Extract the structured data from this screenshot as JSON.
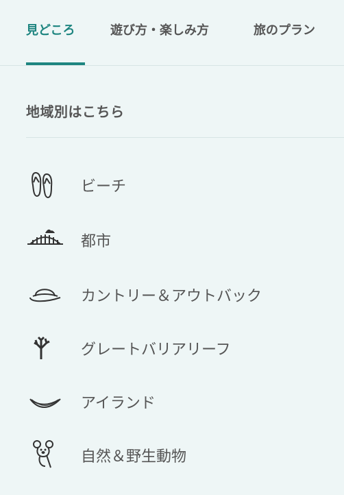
{
  "tabs": {
    "highlights": "見どころ",
    "activities": "遊び方・楽しみ方",
    "travel_plans": "旅のプラン"
  },
  "section": {
    "title": "地域別はこちら"
  },
  "regions": [
    {
      "label": "ビーチ",
      "icon": "flip-flops-icon"
    },
    {
      "label": "都市",
      "icon": "harbour-bridge-icon"
    },
    {
      "label": "カントリー＆アウトバック",
      "icon": "outback-hat-icon"
    },
    {
      "label": "グレートバリアリーフ",
      "icon": "coral-icon"
    },
    {
      "label": "アイランド",
      "icon": "hammock-icon"
    },
    {
      "label": "自然＆野生動物",
      "icon": "koala-icon"
    }
  ],
  "colors": {
    "accent": "#1e8580",
    "background": "#eef6f6",
    "text": "#555555",
    "divider": "#d6e4e4"
  }
}
